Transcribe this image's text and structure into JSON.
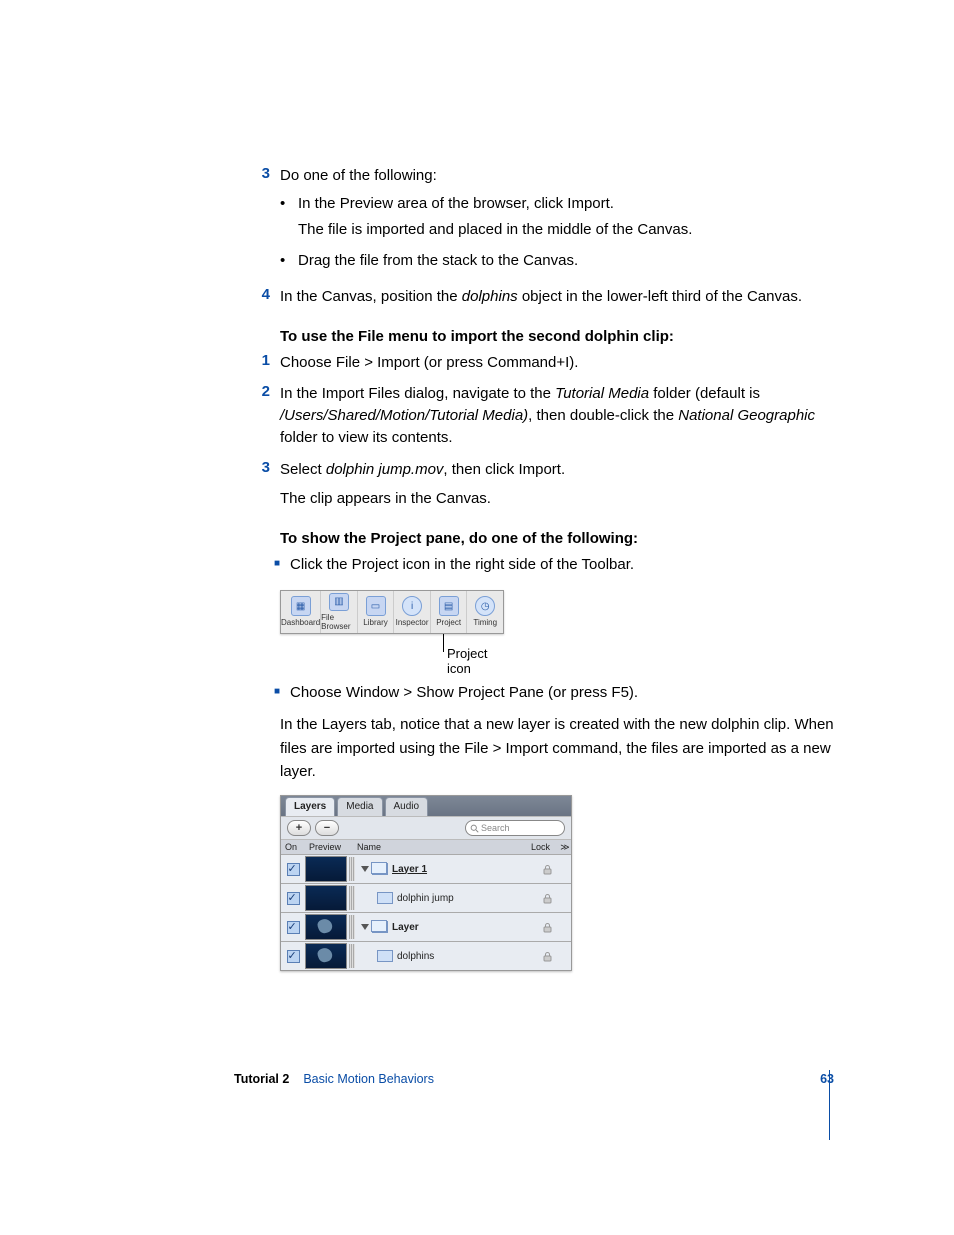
{
  "steps": {
    "s3": {
      "num": "3",
      "text": "Do one of the following:"
    },
    "s3a": "In the Preview area of the browser, click Import.",
    "s3a_follow": "The file is imported and placed in the middle of the Canvas.",
    "s3b": "Drag the file from the stack to the Canvas.",
    "s4": {
      "num": "4",
      "pre": "In the Canvas, position the ",
      "italic": "dolphins",
      "post": " object in the lower-left third of the Canvas."
    }
  },
  "heading1": "To use the File menu to import the second dolphin clip:",
  "file_steps": {
    "f1": {
      "num": "1",
      "pre": "Choose File > Import (or press ",
      "key": "Command+I",
      "post": ")."
    },
    "f2": {
      "num": "2",
      "pre": "In the Import Files dialog, navigate to the ",
      "it1": "Tutorial Media",
      "mid1": " folder (default is ",
      "it2": "/Users/Shared/Motion/Tutorial Media)",
      "mid2": ", then double-click the ",
      "it3": "National Geographic",
      "post": " folder to view its contents."
    },
    "f3": {
      "num": "3",
      "pre": "Select ",
      "it": "dolphin jump.mov",
      "post": ", then click Import."
    },
    "f3_follow": "The clip appears in the Canvas."
  },
  "heading2": "To show the Project pane, do one of the following:",
  "proj_a": "Click the Project icon in the right side of the Toolbar.",
  "toolbar_btns": [
    "Dashboard",
    "File Browser",
    "Library",
    "Inspector",
    "Project",
    "Timing"
  ],
  "callout": "Project icon",
  "proj_b": {
    "pre": "Choose Window > Show Project Pane (or press ",
    "key": "F5",
    "post": ")."
  },
  "layers_para": "In the Layers tab, notice that a new layer is created with the new dolphin clip. When files are imported using the File > Import command, the files are imported as a new layer.",
  "layers": {
    "tabs": [
      "Layers",
      "Media",
      "Audio"
    ],
    "plus": "+",
    "minus": "−",
    "search_placeholder": "Search",
    "cols": {
      "on": "On",
      "preview": "Preview",
      "name": "Name",
      "lock": "Lock",
      "more": "≫"
    },
    "rows": [
      {
        "name": "Layer 1",
        "type": "layer"
      },
      {
        "name": "dolphin jump",
        "type": "clip"
      },
      {
        "name": "Layer",
        "type": "layer"
      },
      {
        "name": "dolphins",
        "type": "clip"
      }
    ]
  },
  "footer": {
    "tut": "Tutorial 2",
    "title": "Basic Motion Behaviors",
    "page": "63"
  }
}
